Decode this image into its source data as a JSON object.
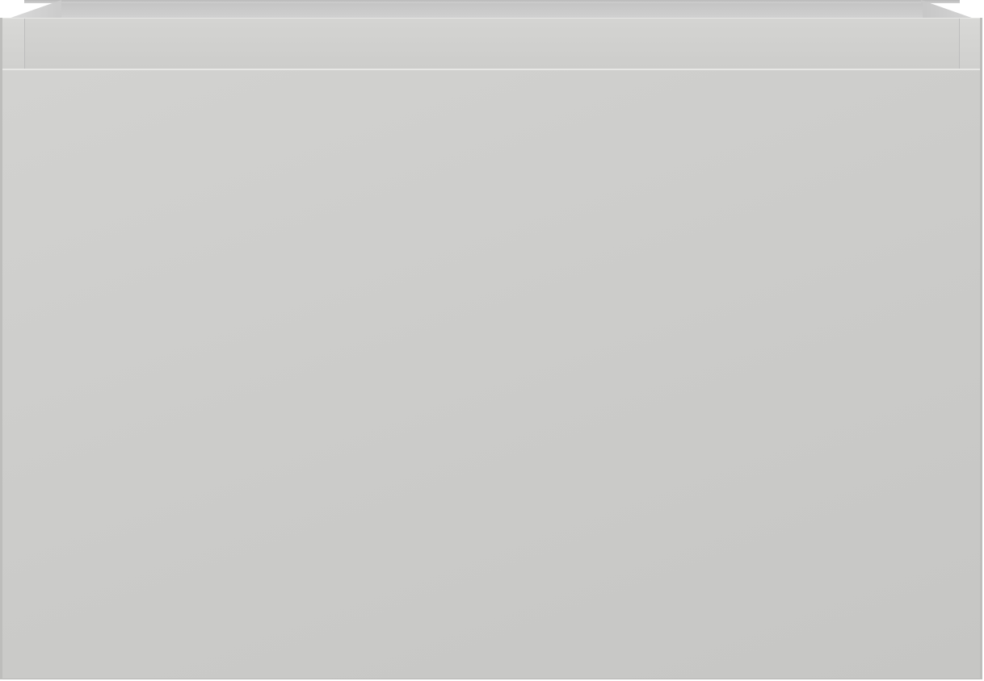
{
  "scene": {
    "subject": "cabinet-box",
    "colors": {
      "panel": "#cccccb",
      "rim": "#d4d4d2",
      "edge": "#bdbdbb"
    }
  }
}
